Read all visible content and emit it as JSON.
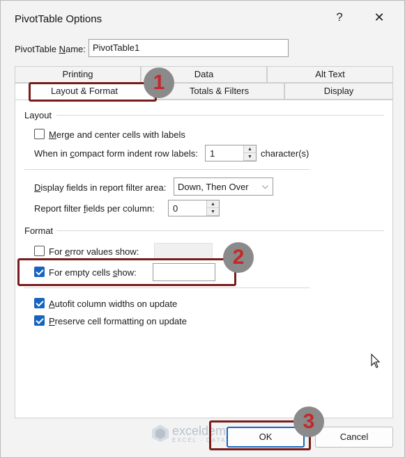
{
  "window": {
    "title": "PivotTable Options",
    "help_glyph": "?",
    "close_glyph": "✕"
  },
  "name_field": {
    "label_pre": "PivotTable ",
    "label_ul": "N",
    "label_post": "ame:",
    "value": "PivotTable1"
  },
  "tabs": {
    "row1": [
      "Printing",
      "Data",
      "Alt Text"
    ],
    "row2": [
      "Layout & Format",
      "Totals & Filters",
      "Display"
    ]
  },
  "layout": {
    "title": "Layout",
    "merge_cells": {
      "checked": false,
      "pre": "",
      "ul": "M",
      "post": "erge and center cells with labels"
    },
    "indent": {
      "pre": "When in ",
      "ul": "c",
      "post": "ompact form indent row labels:",
      "value": "1",
      "suffix": "character(s)"
    },
    "display_fields": {
      "pre": "",
      "ul": "D",
      "post": "isplay fields in report filter area:",
      "value": "Down, Then Over"
    },
    "filter_fields": {
      "pre": "Report filter ",
      "ul": "f",
      "post": "ields per column:",
      "value": "0"
    }
  },
  "format": {
    "title": "Format",
    "error_values": {
      "checked": false,
      "pre": "For ",
      "ul": "e",
      "post": "rror values show:"
    },
    "empty_cells": {
      "checked": true,
      "pre": "For empty cells ",
      "ul": "s",
      "post": "how:"
    },
    "autofit": {
      "checked": true,
      "pre": "",
      "ul": "A",
      "post": "utofit column widths on update"
    },
    "preserve": {
      "checked": true,
      "pre": "",
      "ul": "P",
      "post": "reserve cell formatting on update"
    }
  },
  "buttons": {
    "ok": "OK",
    "cancel": "Cancel"
  },
  "annotations": {
    "badge1": "1",
    "badge2": "2",
    "badge3": "3"
  },
  "watermark": {
    "name": "exceldemy",
    "tagline": "EXCEL · DATA · BI"
  },
  "colors": {
    "accent": "#1565c0",
    "highlight": "#7a1b1b",
    "badge_fill": "#8a8a8a",
    "badge_text": "#c62828"
  }
}
